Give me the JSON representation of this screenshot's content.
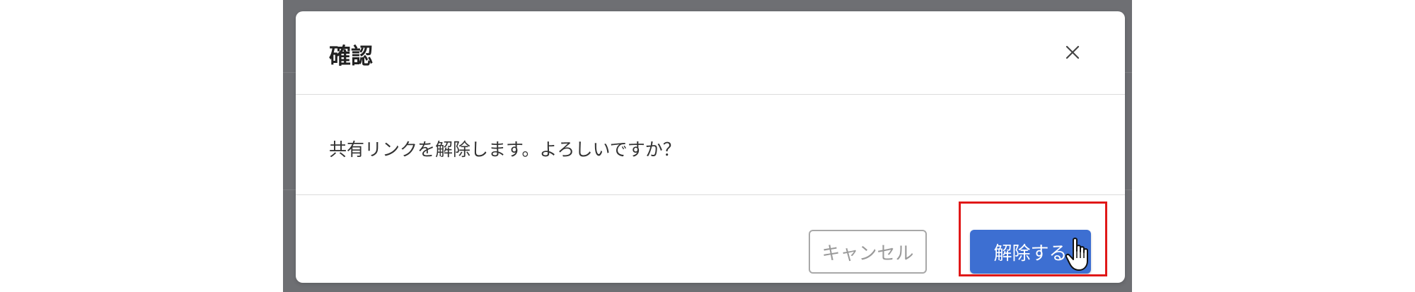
{
  "dialog": {
    "title": "確認",
    "message": "共有リンクを解除します。よろしいですか？",
    "close_icon": "close-icon",
    "buttons": {
      "cancel_label": "キャンセル",
      "confirm_label": "解除する"
    }
  },
  "colors": {
    "overlay": "#6e6f73",
    "confirm_button": "#3d6fd2",
    "highlight": "#e01818"
  }
}
